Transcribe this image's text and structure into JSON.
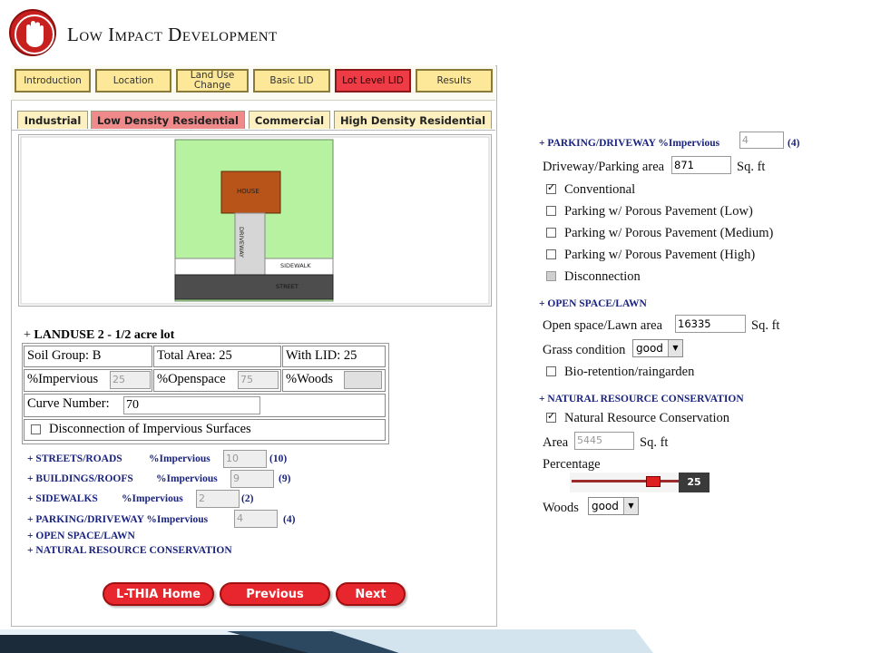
{
  "header": {
    "title_prefix_L": "L",
    "title_word1_rest": "ow",
    "title_prefix_I": "I",
    "title_word2_rest": "mpact",
    "title_prefix_D": "D",
    "title_word3_rest": "evelopment",
    "logo_icon": "hand-stop-icon",
    "logo_color": "#c8201e"
  },
  "nav_tabs": [
    {
      "label": "Introduction"
    },
    {
      "label": "Location"
    },
    {
      "label": "Land Use Change"
    },
    {
      "label": "Basic LID"
    },
    {
      "label": "Lot Level LID",
      "active": true
    },
    {
      "label": "Results"
    }
  ],
  "landuse_tabs": [
    {
      "label": "Industrial"
    },
    {
      "label": "Low Density Residential",
      "active": true
    },
    {
      "label": "Commercial"
    },
    {
      "label": "High Density Residential"
    }
  ],
  "map": {
    "house_label": "HOUSE",
    "driveway_label": "DRIVEWAY",
    "sidewalk_label": "SIDEWALK",
    "street_label": "STREET",
    "lawn_color": "#b6f2a0",
    "house_color": "#b8541a",
    "street_color": "#4d4d4d"
  },
  "landuse": {
    "plus": "+",
    "title": "LANDUSE 2 - 1/2 acre lot",
    "soil_group": "Soil Group: B",
    "total_area": "Total Area: 25",
    "with_lid": "With LID: 25",
    "impervious_label": "%Impervious",
    "impervious_value": "25",
    "openspace_label": "%Openspace",
    "openspace_value": "75",
    "woods_label": "%Woods",
    "woods_value": "",
    "curve_label": "Curve Number:",
    "curve_value": "70",
    "disconnection_label": "Disconnection of Impervious Surfaces"
  },
  "summary": [
    {
      "label": "+ STREETS/ROADS",
      "pct_label": "%Impervious",
      "value": "10",
      "paren": "(10)"
    },
    {
      "label": "+ BUILDINGS/ROOFS",
      "pct_label": "%Impervious",
      "value": "9",
      "paren": "(9)"
    },
    {
      "label": "+ SIDEWALKS",
      "pct_label": "%Impervious",
      "value": "2",
      "paren": "(2)"
    },
    {
      "label": "+ PARKING/DRIVEWAY %Impervious",
      "pct_label": "",
      "value": "4",
      "paren": "(4)"
    },
    {
      "label": "+ OPEN SPACE/LAWN"
    },
    {
      "label": "+ NATURAL RESOURCE CONSERVATION"
    }
  ],
  "buttons": {
    "home": "L-THIA Home",
    "previous": "Previous",
    "next": "Next"
  },
  "right": {
    "parking": {
      "heading": "+ PARKING/DRIVEWAY %Impervious",
      "value": "4",
      "paren": "(4)",
      "area_label": "Driveway/Parking area",
      "area_value": "871",
      "unit": "Sq. ft",
      "options": [
        {
          "label": "Conventional",
          "checked": true
        },
        {
          "label": "Parking w/ Porous Pavement (Low)",
          "checked": false
        },
        {
          "label": "Parking w/ Porous Pavement (Medium)",
          "checked": false
        },
        {
          "label": "Parking w/ Porous Pavement (High)",
          "checked": false
        },
        {
          "label": "Disconnection",
          "checked": false,
          "disabled": true
        }
      ]
    },
    "openspace": {
      "heading": "+ OPEN SPACE/LAWN",
      "area_label": "Open space/Lawn area",
      "area_value": "16335",
      "unit": "Sq. ft",
      "grass_label": "Grass condition",
      "grass_value": "good",
      "bio_label": "Bio-retention/raingarden"
    },
    "natural": {
      "heading": "+ NATURAL RESOURCE CONSERVATION",
      "checkbox_label": "Natural Resource Conservation",
      "area_label": "Area",
      "area_value": "5445",
      "unit": "Sq. ft",
      "percentage_label": "Percentage",
      "percentage_value": "25",
      "slider_fraction": 0.25,
      "woods_label": "Woods",
      "woods_value": "good"
    }
  }
}
